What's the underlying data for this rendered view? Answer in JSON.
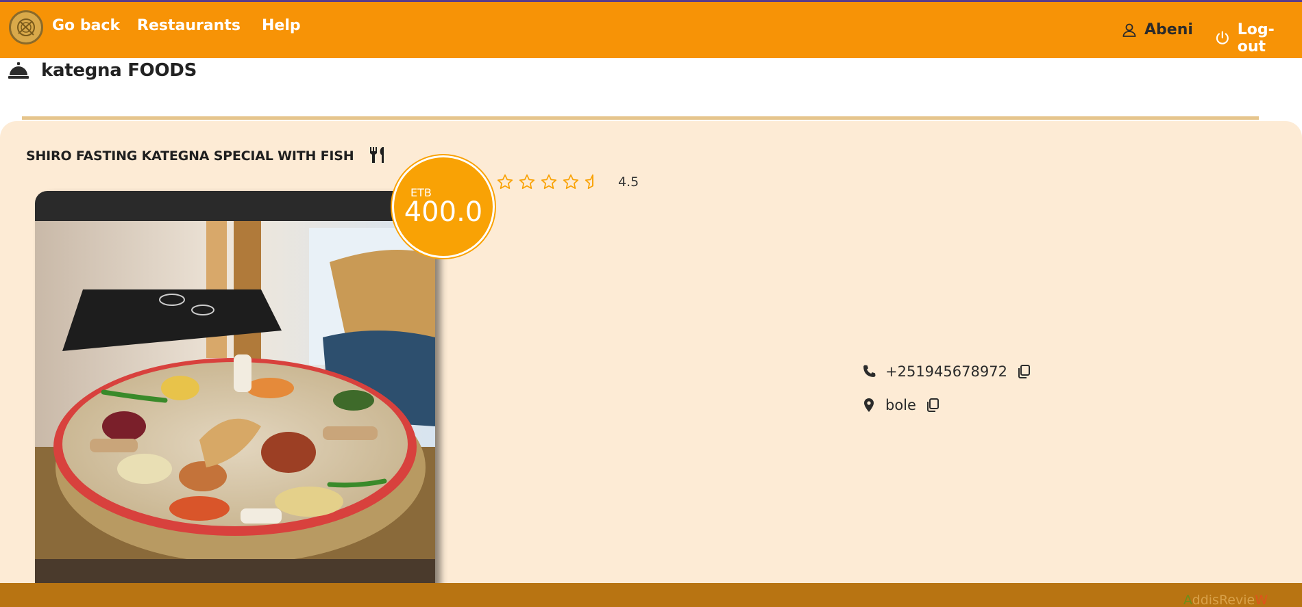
{
  "nav": {
    "go_back": "Go back",
    "restaurants": "Restaurants",
    "help": "Help",
    "user": "Abeni",
    "logout": "Log-out"
  },
  "restaurant": {
    "name": "kategna FOODS",
    "icon": "service-bell-icon"
  },
  "dish": {
    "title": "SHIRO FASTING KATEGNA SPECIAL WITH FISH",
    "currency": "ETB",
    "price": "400.0",
    "rating": 4.5,
    "rating_text": "4.5",
    "phone": "+251945678972",
    "location": "bole"
  },
  "footer": {
    "brand_a": "A",
    "brand_mid": "ddisRevie",
    "brand_w": "W"
  },
  "colors": {
    "nav_bg": "#f79306",
    "card_bg": "#fdebd5",
    "accent": "#f9a205",
    "footer_bg": "#b87412"
  }
}
